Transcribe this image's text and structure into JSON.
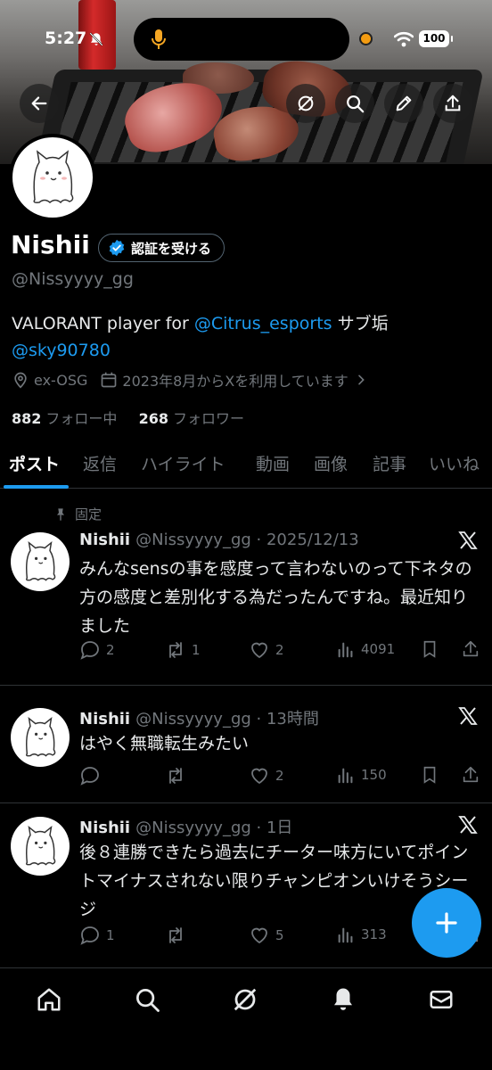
{
  "status_bar": {
    "time": "5:27",
    "battery": "100"
  },
  "profile": {
    "name": "Nishii",
    "verify_label": "認証を受ける",
    "handle": "@Nissyyyy_gg",
    "bio_prefix": "VALORANT player for ",
    "bio_link1": "@Citrus_esports",
    "bio_mid": " サブ垢",
    "bio_link2": "@sky90780",
    "location": "ex-OSG",
    "joined": "2023年8月からXを利用しています",
    "following_count": "882",
    "following_label": "フォロー中",
    "followers_count": "268",
    "followers_label": "フォロワー"
  },
  "tabs": [
    "ポスト",
    "返信",
    "ハイライト",
    "動画",
    "画像",
    "記事",
    "いいね"
  ],
  "pinned_label": "固定",
  "posts": [
    {
      "name": "Nishii",
      "meta": "@Nissyyyy_gg · 2025/12/13",
      "text": "みんなsensの事を感度って言わないのって下ネタの方の感度と差別化する為だったんですね。最近知りました",
      "replies": "2",
      "reposts": "1",
      "likes": "2",
      "views": "4091"
    },
    {
      "name": "Nishii",
      "meta": "@Nissyyyy_gg · 13時間",
      "text": "はやく無職転生みたい",
      "replies": "",
      "reposts": "",
      "likes": "2",
      "views": "150"
    },
    {
      "name": "Nishii",
      "meta": "@Nissyyyy_gg · 1日",
      "text": "後８連勝できたら過去にチーター味方にいてポイントマイナスされない限りチャンピオンいけそうシージ",
      "replies": "1",
      "reposts": "",
      "likes": "5",
      "views": "313"
    }
  ],
  "colors": {
    "accent": "#1d9bf0",
    "muted": "#71767b",
    "background": "#000000"
  },
  "icons": [
    "back-arrow-icon",
    "grok-icon",
    "search-icon",
    "pencil-icon",
    "share-icon",
    "verified-badge-icon",
    "location-icon",
    "calendar-icon",
    "pin-icon",
    "x-logo-icon",
    "reply-icon",
    "repost-icon",
    "like-icon",
    "views-icon",
    "bookmark-icon",
    "plus-icon",
    "home-icon",
    "notification-bell-icon",
    "mail-icon"
  ]
}
